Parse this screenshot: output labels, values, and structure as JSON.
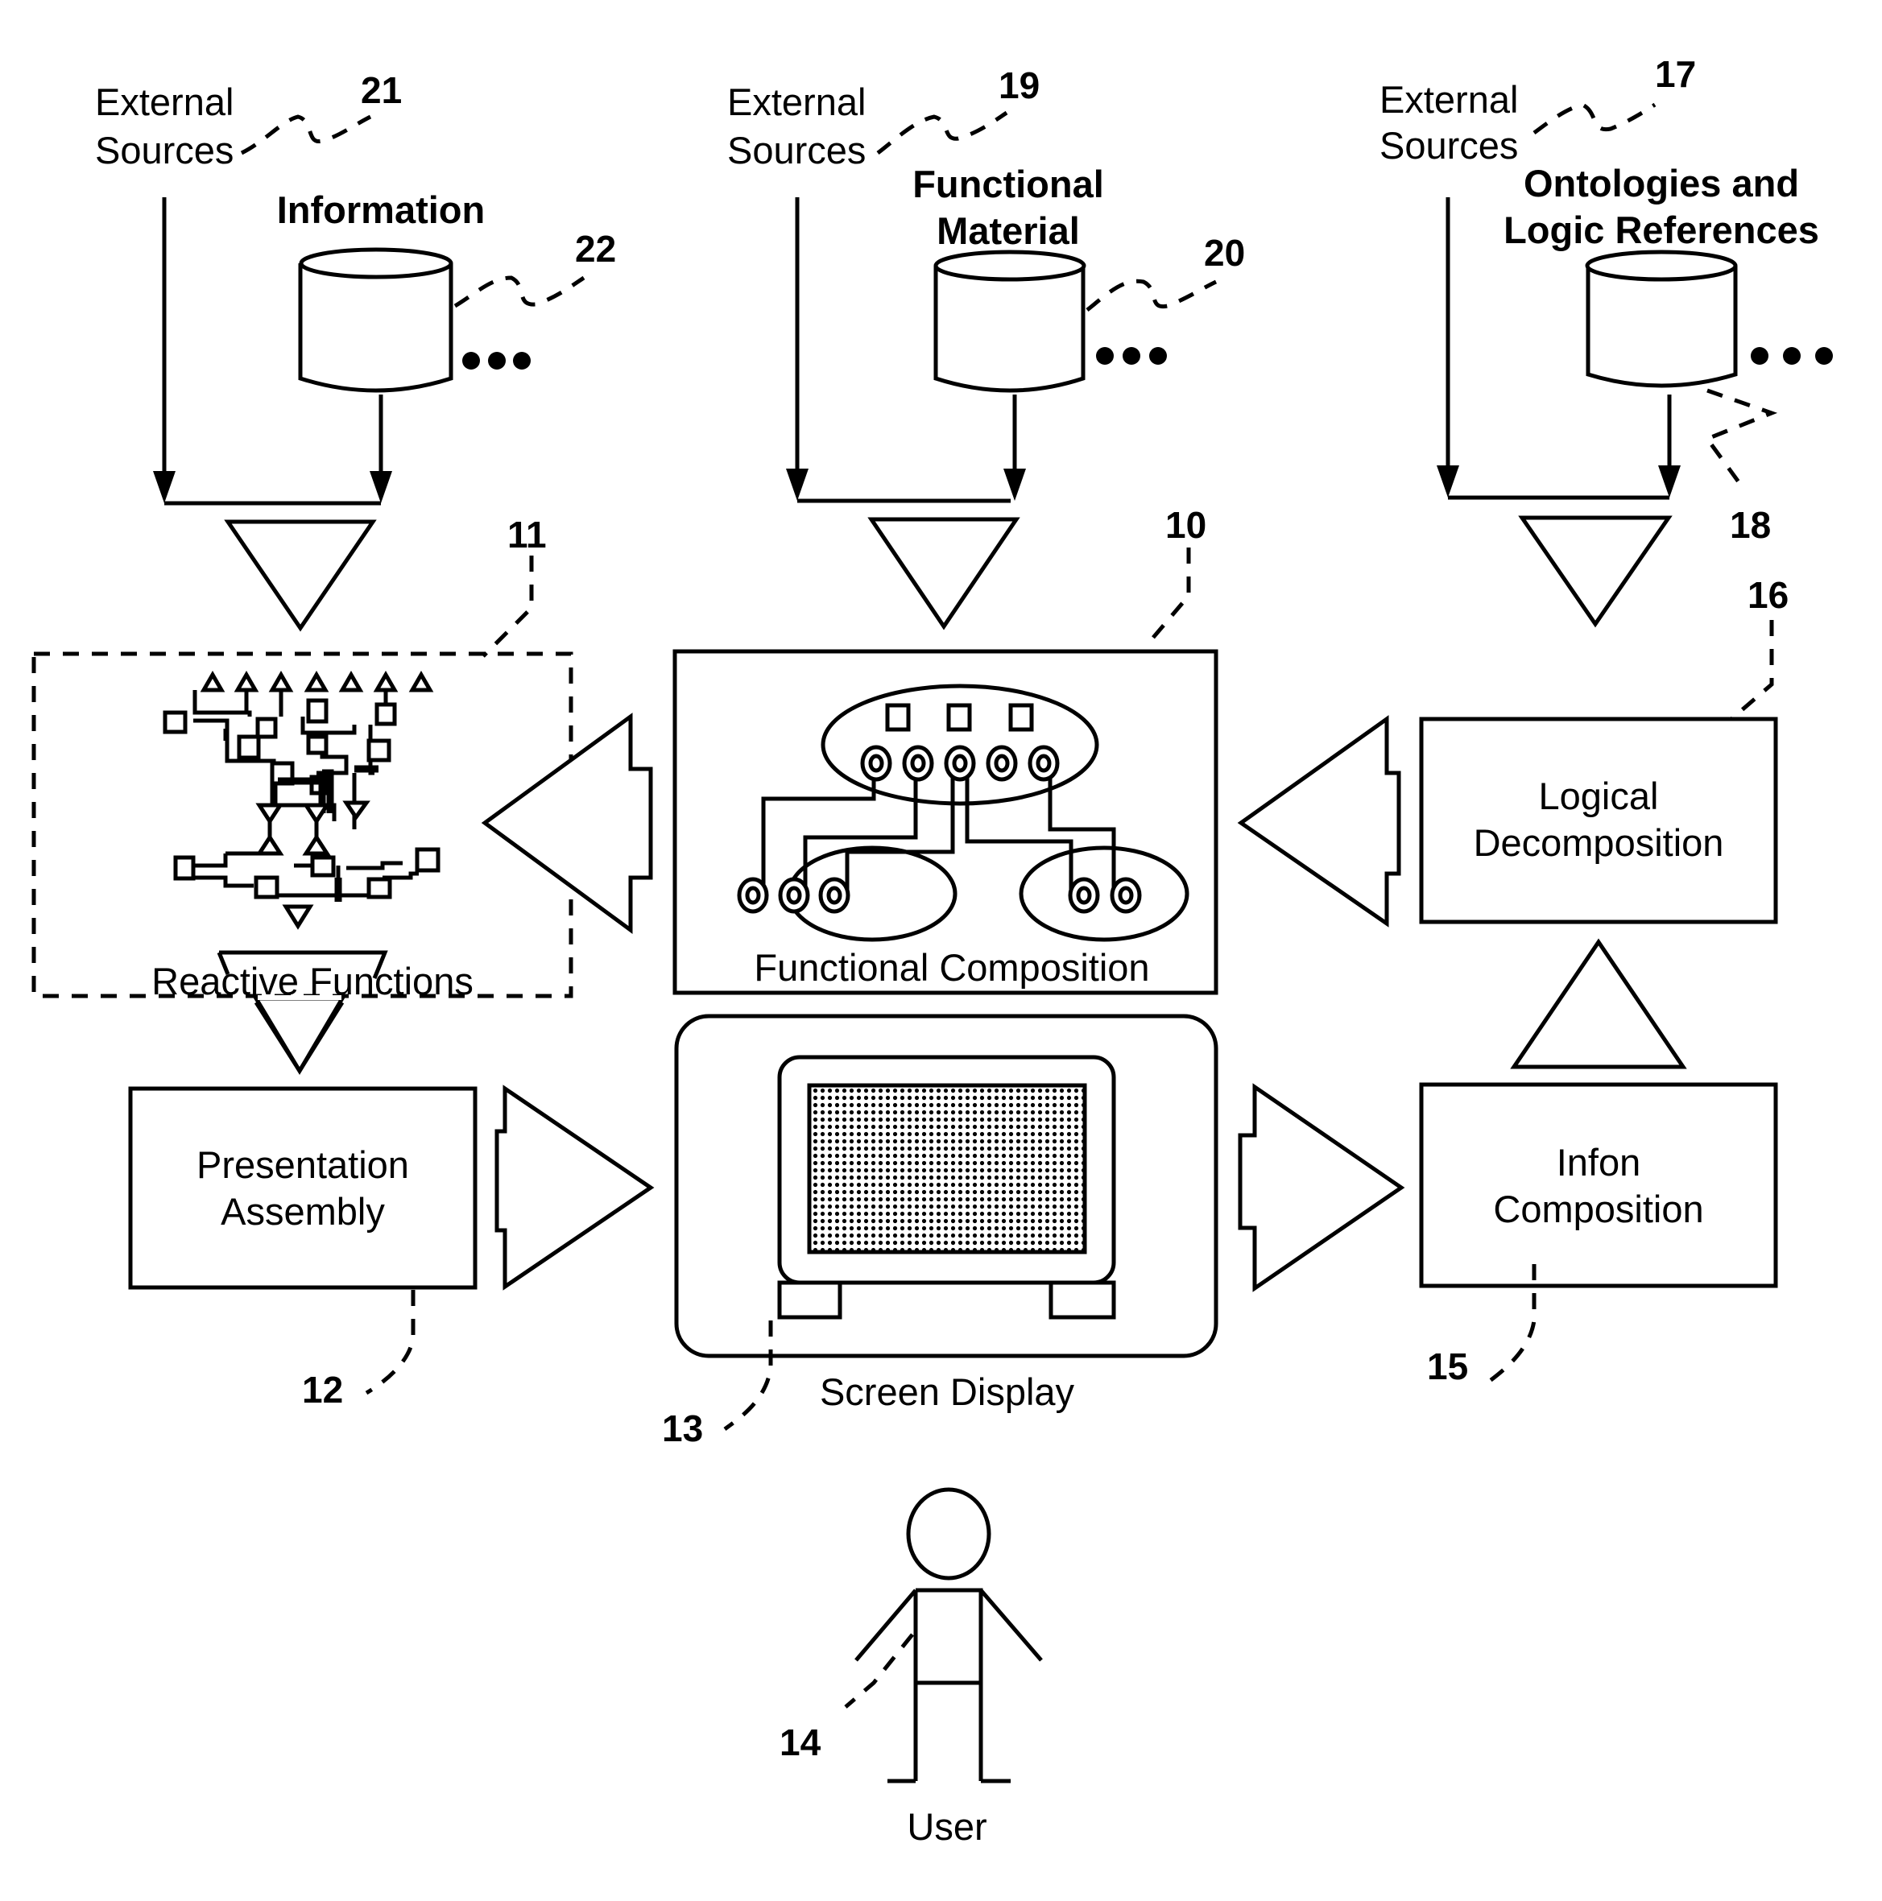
{
  "diagram": {
    "columns": {
      "left": {
        "source_label_line1": "External",
        "source_label_line2": "Sources",
        "source_ref": "21",
        "store_title_line1": "Information",
        "store_ref": "22"
      },
      "center": {
        "source_label_line1": "External",
        "source_label_line2": "Sources",
        "source_ref": "19",
        "store_title_line1": "Functional",
        "store_title_line2": "Material",
        "store_ref": "20"
      },
      "right": {
        "source_label_line1": "External",
        "source_label_line2": "Sources",
        "source_ref": "17",
        "store_title_line1": "Ontologies and",
        "store_title_line2": "Logic References",
        "store_ref": "18"
      }
    },
    "blocks": {
      "reactive_functions": {
        "label": "Reactive Functions",
        "ref": "11"
      },
      "functional_composition": {
        "label": "Functional Composition",
        "ref": "10"
      },
      "logical_decomposition": {
        "label_line1": "Logical",
        "label_line2": "Decomposition",
        "ref": "16"
      },
      "presentation_assembly": {
        "label_line1": "Presentation",
        "label_line2": "Assembly",
        "ref": "12"
      },
      "screen_display": {
        "label": "Screen Display",
        "ref": "13"
      },
      "infon_composition": {
        "label_line1": "Infon",
        "label_line2": "Composition",
        "ref": "15"
      },
      "user": {
        "label": "User",
        "ref": "14"
      }
    }
  }
}
